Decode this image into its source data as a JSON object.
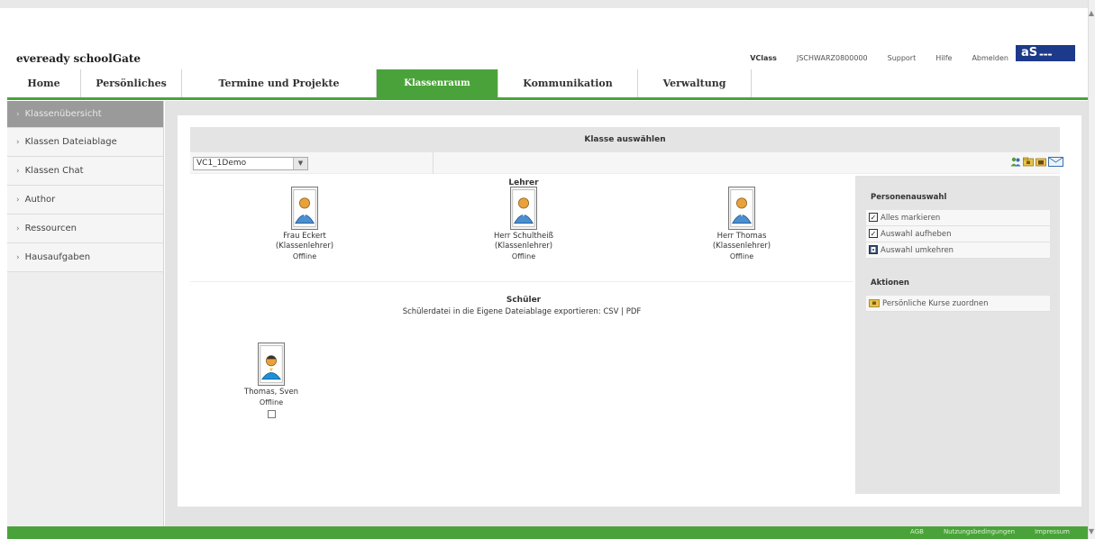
{
  "header": {
    "app_title": "eveready schoolGate",
    "links": {
      "vclass": "VClass",
      "user": "JSCHWARZ0800000",
      "support": "Support",
      "help": "Hilfe",
      "logout": "Abmelden"
    },
    "logo_text": "aS"
  },
  "nav": {
    "tabs": [
      {
        "label": "Home"
      },
      {
        "label": "Persönliches"
      },
      {
        "label": "Termine und Projekte"
      },
      {
        "label": "Klassenraum",
        "active": true
      },
      {
        "label": "Kommunikation"
      },
      {
        "label": "Verwaltung"
      }
    ]
  },
  "sidebar": {
    "items": [
      {
        "label": "Klassenübersicht",
        "active": true
      },
      {
        "label": "Klassen Dateiablage"
      },
      {
        "label": "Klassen Chat"
      },
      {
        "label": "Author"
      },
      {
        "label": "Ressourcen"
      },
      {
        "label": "Hausaufgaben"
      }
    ]
  },
  "main": {
    "class_header": "Klasse auswählen",
    "class_select_value": "VC1_1Demo",
    "teachers_label": "Lehrer",
    "teachers": [
      {
        "name": "Frau Eckert",
        "role": "(Klassenlehrer)",
        "status": "Offline"
      },
      {
        "name": "Herr Schultheiß",
        "role": "(Klassenlehrer)",
        "status": "Offline"
      },
      {
        "name": "Herr Thomas",
        "role": "(Klassenlehrer)",
        "status": "Offline"
      }
    ],
    "students_label": "Schüler",
    "export_text": "Schülerdatei in die Eigene Dateiablage exportieren: CSV | PDF",
    "students": [
      {
        "name": "Thomas, Sven",
        "status": "Offline"
      }
    ]
  },
  "right_panel": {
    "selection_title": "Personenauswahl",
    "select_all": "Alles markieren",
    "deselect": "Auswahl aufheben",
    "invert": "Auswahl umkehren",
    "actions_title": "Aktionen",
    "action_courses": "Persönliche Kurse zuordnen"
  },
  "footer": {
    "agb": "AGB",
    "terms": "Nutzungsbedingungen",
    "imprint": "Impressum"
  },
  "colors": {
    "accent_green": "#4aa33a",
    "logo_blue": "#1d3a8a"
  }
}
